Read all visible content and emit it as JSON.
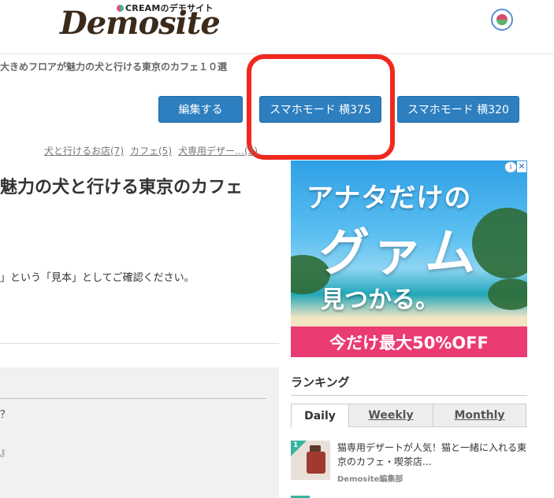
{
  "header": {
    "logo_sub": "CREAMのデモサイト",
    "logo_main": "Demosite"
  },
  "breadcrumb": "大きめフロアが魅力の犬と行ける東京のカフェ１０選",
  "buttons": {
    "edit": "編集する",
    "smartphone_375": "スマホモード 横375",
    "smartphone_320": "スマホモード 横320"
  },
  "tags": [
    "犬と行けるお店(7)",
    "カフェ(5)",
    "犬専用デザー…(3)"
  ],
  "article": {
    "title": "魅力の犬と行ける東京のカフェ",
    "intro": "」という「見本」としてご確認ください。",
    "toc_item_1": "？",
    "toc_item_2": "』"
  },
  "ad": {
    "line1": "アナタだけの",
    "line2": "グァム",
    "line3": "見つかる。",
    "band": "今だけ最大50%OFF",
    "info": "i",
    "close": "✕"
  },
  "ranking": {
    "title": "ランキング",
    "tabs": [
      "Daily",
      "Weekly",
      "Monthly"
    ],
    "active_tab": "Daily",
    "items": [
      {
        "rank": "1",
        "title": "猫専用デザートが人気！猫と一緒に入れる東京のカフェ・喫茶店...",
        "author": "Demosite編集部"
      }
    ]
  },
  "colors": {
    "button_blue": "#2d7fbf",
    "highlight_red": "#f0281e",
    "rank_badge": "#36b3a2",
    "ad_band": "#ea3b73"
  }
}
